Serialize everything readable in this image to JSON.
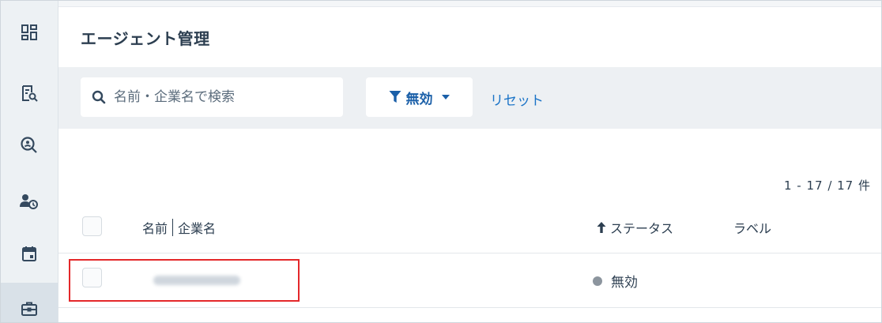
{
  "sidebar": {
    "items": [
      {
        "icon": "dashboard-icon"
      },
      {
        "icon": "report-search-icon"
      },
      {
        "icon": "person-search-icon"
      },
      {
        "icon": "user-clock-icon"
      },
      {
        "icon": "calendar-icon"
      },
      {
        "icon": "briefcase-icon"
      }
    ],
    "active_index": 5
  },
  "header": {
    "title": "エージェント管理"
  },
  "filters": {
    "search_placeholder": "名前・企業名で検索",
    "status_filter_label": "無効",
    "reset_label": "リセット"
  },
  "pagination": {
    "count_text": "1 - 17 / 17 件"
  },
  "table": {
    "columns": {
      "name": "名前",
      "company": "企業名",
      "status": "ステータス",
      "label": "ラベル"
    },
    "rows": [
      {
        "name": "",
        "status": "無効",
        "status_color": "#8c959e"
      }
    ]
  },
  "colors": {
    "accent": "#1a73c7",
    "highlight": "#e4282a"
  }
}
